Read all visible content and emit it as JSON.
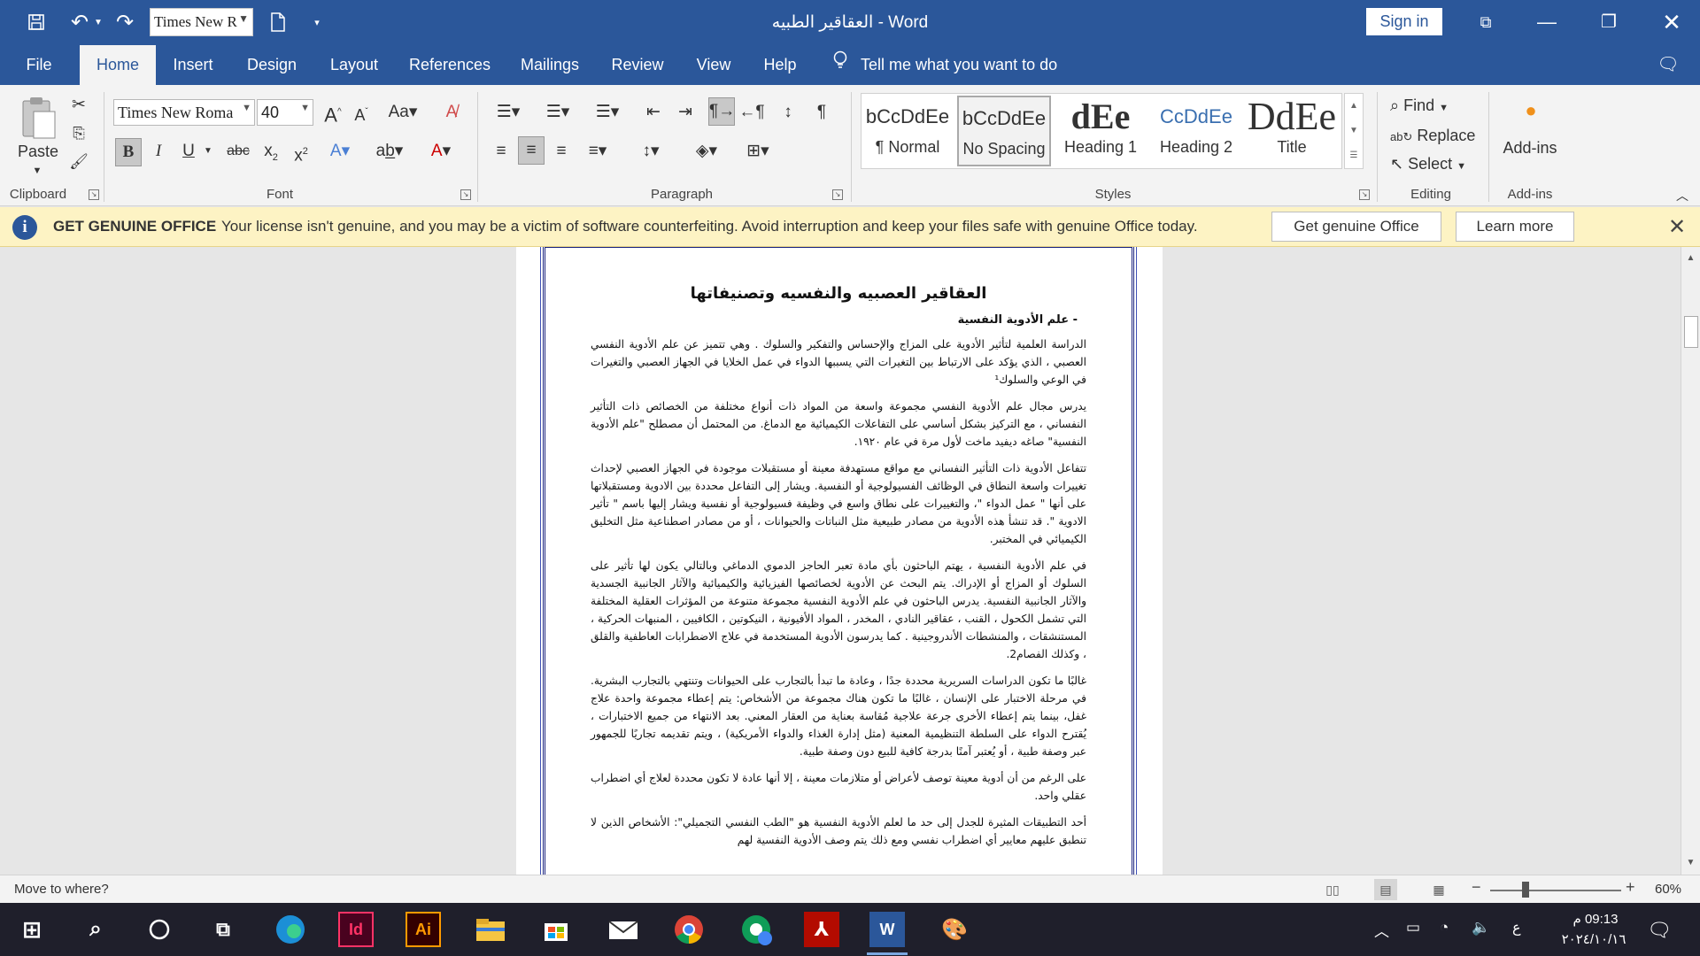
{
  "titlebar": {
    "doc_title": "العقاقير الطبيه  -  Word",
    "font_quick_value": "Times New R",
    "sign_in": "Sign in"
  },
  "tabs": [
    {
      "label": "File"
    },
    {
      "label": "Home"
    },
    {
      "label": "Insert"
    },
    {
      "label": "Design"
    },
    {
      "label": "Layout"
    },
    {
      "label": "References"
    },
    {
      "label": "Mailings"
    },
    {
      "label": "Review"
    },
    {
      "label": "View"
    },
    {
      "label": "Help"
    }
  ],
  "tell_me": "Tell me what you want to do",
  "ribbon": {
    "clipboard": {
      "paste": "Paste",
      "group": "Clipboard"
    },
    "font": {
      "name": "Times New Roma",
      "size": "40",
      "group": "Font"
    },
    "paragraph": {
      "group": "Paragraph"
    },
    "styles": {
      "group": "Styles",
      "items": [
        {
          "preview": "bCcDdEe",
          "name": "¶ Normal"
        },
        {
          "preview": "bCcDdEe",
          "name": "No Spacing"
        },
        {
          "preview": "dEe",
          "name": "Heading 1"
        },
        {
          "preview": "CcDdEe",
          "name": "Heading 2"
        },
        {
          "preview": "DdEe",
          "name": "Title"
        }
      ]
    },
    "editing": {
      "find": "Find",
      "replace": "Replace",
      "select": "Select",
      "group": "Editing"
    },
    "addins": {
      "label": "Add-ins",
      "group": "Add-ins"
    }
  },
  "infobar": {
    "title": "GET GENUINE OFFICE",
    "message": "Your license isn't genuine, and you may be a victim of software counterfeiting. Avoid interruption and keep your files safe with genuine Office today.",
    "get_button": "Get genuine Office",
    "learn_button": "Learn more"
  },
  "document": {
    "heading": "العقاقير العصبيه والنفسيه وتصنيفاتها",
    "subheading": "علم الأدوية النفسية",
    "paragraphs": [
      "الدراسة العلمية لتأثير الأدوية على المزاج والإحساس والتفكير والسلوك . وهي تتميز عن علم الأدوية النفسي العصبي ، الذي يؤكد على الارتباط بين التغيرات التي يسببها الدواء في عمل الخلايا في الجهاز العصبي والتغيرات في الوعي والسلوك¹",
      "يدرس مجال علم الأدوية النفسي مجموعة واسعة من المواد ذات أنواع مختلفة من الخصائص ذات التأثير النفساني ، مع التركيز بشكل أساسي على التفاعلات الكيميائية مع الدماغ. من المحتمل أن مصطلح \"علم الأدوية النفسية\" صاغه ديفيد ماخت لأول مرة في عام ١٩٢٠.",
      "تتفاعل الأدوية ذات التأثير النفساني مع مواقع مستهدفة معينة أو مستقبلات موجودة في الجهاز العصبي لإحداث تغييرات واسعة النطاق في الوظائف الفسيولوجية أو النفسية. ويشار إلى التفاعل محددة بين الادوية ومستقبلاتها على أنها \" عمل الدواء \"، والتغييرات على نطاق واسع في وظيفة فسيولوجية أو نفسية ويشار إليها باسم \" تأثير الادوية \". قد تنشأ هذه الأدوية من مصادر طبيعية مثل النباتات والحيوانات ، أو من مصادر اصطناعية مثل التخليق الكيميائي في المختبر.",
      "في علم الأدوية النفسية ، يهتم الباحثون بأي مادة تعبر الحاجز الدموي الدماغي وبالتالي يكون لها تأثير على السلوك أو المزاج أو الإدراك. يتم البحث عن الأدوية لخصائصها الفيزيائية والكيميائية والآثار الجانبية الجسدية والآثار الجانبية النفسية. يدرس الباحثون في علم الأدوية النفسية مجموعة متنوعة من المؤثرات العقلية المختلفة التي تشمل الكحول ، القنب ، عقاقير النادي ، المخدر ، المواد الأفيونية ، النيكوتين ، الكافيين ، المنبهات الحركية ، المستنشقات ، والمنشطات الأندروجينية . كما يدرسون الأدوية المستخدمة في علاج الاضطرابات العاطفية والقلق ، وكذلك الفصام2.",
      "غالبًا ما تكون الدراسات السريرية محددة جدًا ، وعادة ما تبدأ بالتجارب على الحيوانات وتنتهي بالتجارب البشرية. في مرحلة الاختبار على الإنسان ، غالبًا ما تكون هناك مجموعة من الأشخاص: يتم إعطاء مجموعة واحدة علاج غفل، بينما يتم إعطاء الأخرى جرعة علاجية مُقاسة بعناية من العقار المعني. بعد الانتهاء من جميع الاختبارات ، يُقترح الدواء على السلطة التنظيمية المعنية (مثل إدارة الغذاء والدواء الأمريكية) ، ويتم تقديمه تجاريًا للجمهور عبر وصفة طبية ، أو يُعتبر آمنًا بدرجة كافية للبيع دون وصفة طبية.",
      "على الرغم من أن أدوية معينة توصف لأعراض أو متلازمات معينة ، إلا أنها عادة لا تكون محددة لعلاج أي اضطراب عقلي واحد.",
      "أحد التطبيقات المثيرة للجدل إلى حد ما لعلم الأدوية النفسية هو \"الطب النفسي التجميلي\": الأشخاص الذين لا تنطبق عليهم معايير أي اضطراب نفسي ومع ذلك يتم وصف الأدوية النفسية لهم"
    ]
  },
  "status": {
    "text": "Move to where?",
    "zoom": "60%",
    "zoom_level": 0.3
  },
  "taskbar": {
    "time": "09:13 م",
    "date": "٢٠٢٤/١٠/١٦",
    "lang": "ع"
  },
  "colors": {
    "word_blue": "#2b579a",
    "infobar": "#fdf3c4",
    "page_border": "#1a237e"
  }
}
